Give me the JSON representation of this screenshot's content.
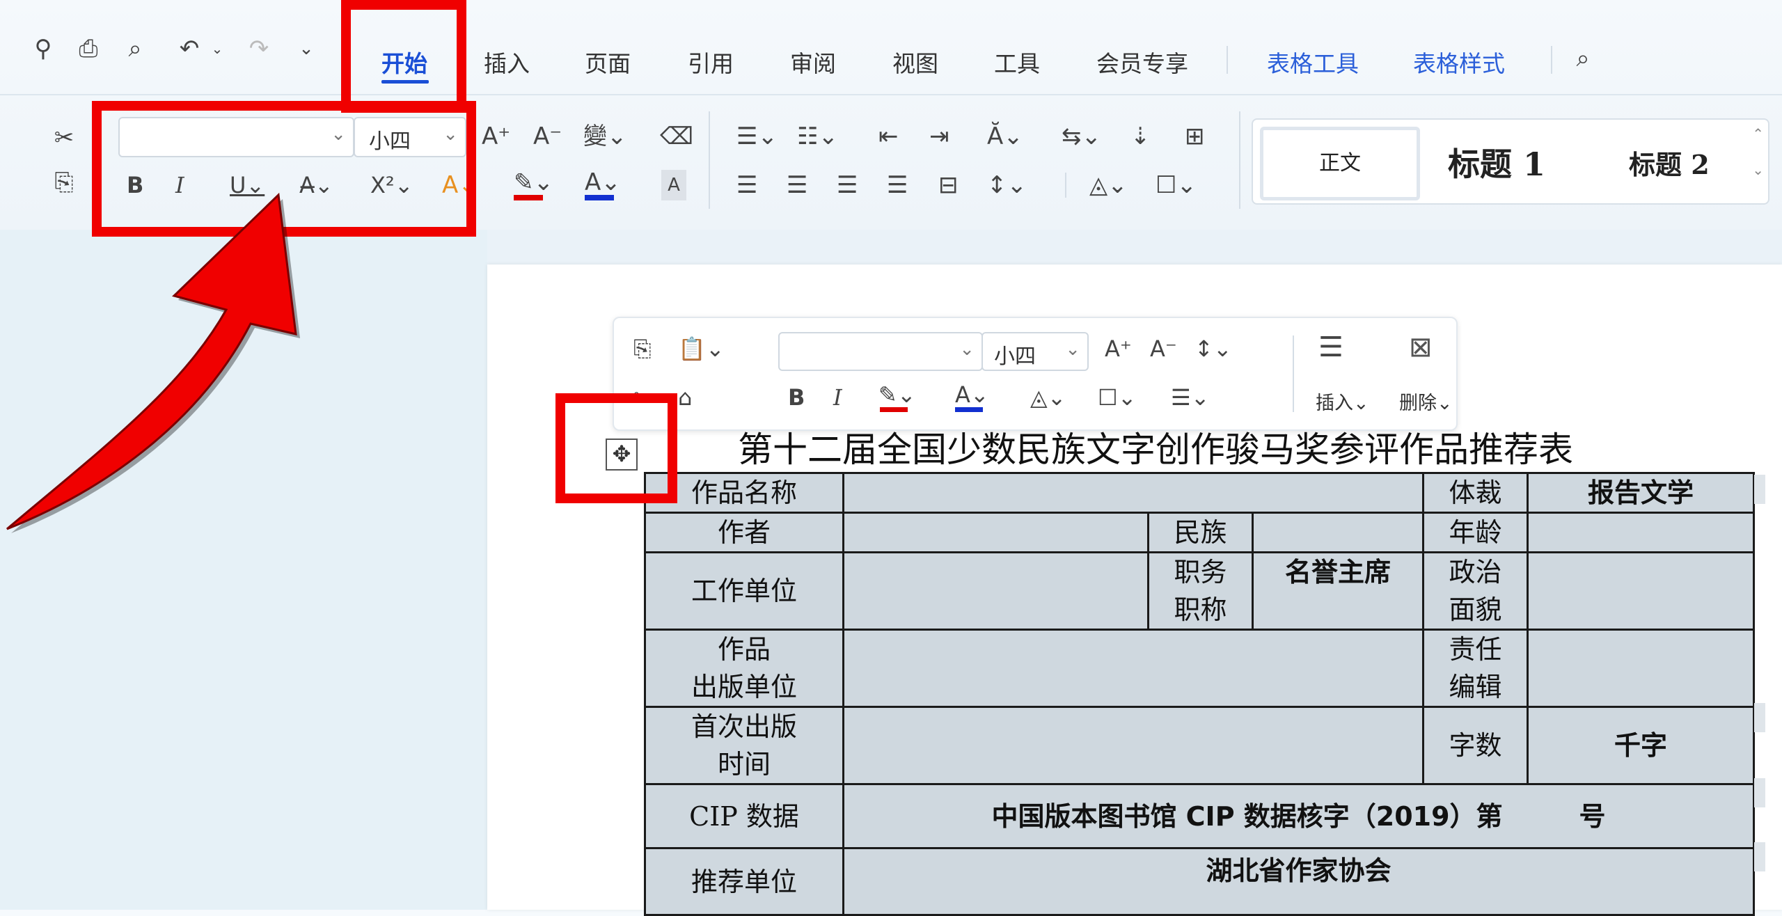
{
  "toolbar": {
    "tabs": [
      {
        "label": "开始",
        "active": true
      },
      {
        "label": "插入"
      },
      {
        "label": "页面"
      },
      {
        "label": "引用"
      },
      {
        "label": "审阅"
      },
      {
        "label": "视图"
      },
      {
        "label": "工具"
      },
      {
        "label": "会员专享"
      },
      {
        "label": "表格工具",
        "accent": "#2b5fd9"
      },
      {
        "label": "表格样式",
        "accent": "#2b5fd9"
      }
    ],
    "font_size": "小四",
    "font_name": "",
    "styles": {
      "normal": "正文",
      "heading1": "标题 1",
      "heading2": "标题 2"
    }
  },
  "mini_toolbar": {
    "font_size": "小四",
    "font_name": "",
    "insert_label": "插入",
    "delete_label": "删除"
  },
  "document": {
    "title": "第十二届全国少数民族文字创作骏马奖参评作品推荐表",
    "table": {
      "work_name_label": "作品名称",
      "genre_label": "体裁",
      "genre_value": "报告文学",
      "author_label": "作者",
      "ethnicity_label": "民族",
      "age_label": "年龄",
      "workplace_label": "工作单位",
      "position_label_1": "职务",
      "position_label_2": "职称",
      "position_value": "名誉主席",
      "political_label_1": "政治",
      "political_label_2": "面貌",
      "publisher_label_1": "作品",
      "publisher_label_2": "出版单位",
      "editor_label_1": "责任",
      "editor_label_2": "编辑",
      "first_pub_label_1": "首次出版",
      "first_pub_label_2": "时间",
      "word_count_label": "字数",
      "word_count_value": "千字",
      "cip_label": "CIP 数据",
      "cip_value_prefix": "中国版本图书馆 CIP 数据核字（2019）第",
      "cip_value_suffix": "号",
      "recommend_label": "推荐单位",
      "recommend_value": "湖北省作家协会"
    }
  },
  "colors": {
    "highlight": "#f00000",
    "accent": "#1a4fd6",
    "table_bg": "#cfd8df"
  }
}
